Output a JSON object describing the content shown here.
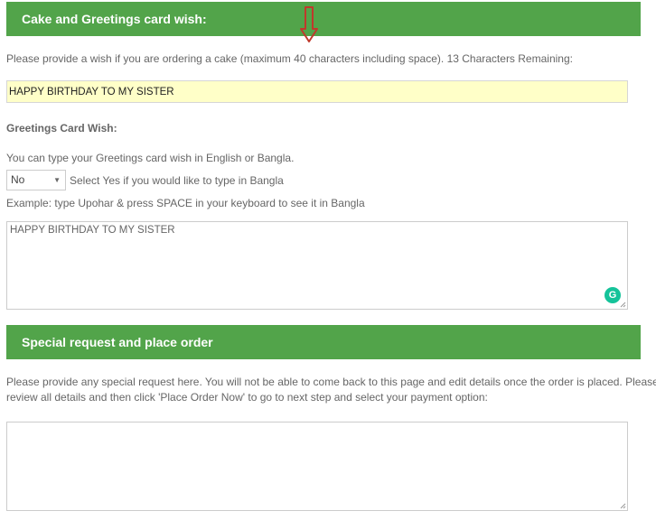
{
  "cake_section": {
    "header": "Cake and Greetings card wish:",
    "instruction": "Please provide a wish if you are ordering a cake (maximum 40 characters including space). 13 Characters Remaining:",
    "cake_wish_value": "HAPPY BIRTHDAY TO MY SISTER"
  },
  "greeting_card": {
    "title": "Greetings Card Wish:",
    "language_note": "You can type your Greetings card wish in English or Bangla.",
    "bangla_select_value": "No",
    "bangla_select_hint": "Select Yes if you would like to type in Bangla",
    "example_text": "Example: type Upohar & press SPACE in your keyboard to see it in Bangla",
    "card_wish_value": "HAPPY BIRTHDAY TO MY SISTER"
  },
  "special_request": {
    "header": "Special request and place order",
    "instruction_line1": "Please provide any special request here. You will not be able to come back to this page and edit details once the order is placed. Please",
    "instruction_line2": "review all details and then click 'Place Order Now' to go to next step and select your payment option:",
    "request_value": ""
  },
  "colors": {
    "header_green": "#52a44a",
    "input_highlight": "#ffffc8",
    "annotation_arrow": "#c0392b"
  },
  "icons": [
    "down-arrow-annotation-icon",
    "grammarly-icon",
    "caret-down-icon",
    "resize-grip-icon"
  ]
}
